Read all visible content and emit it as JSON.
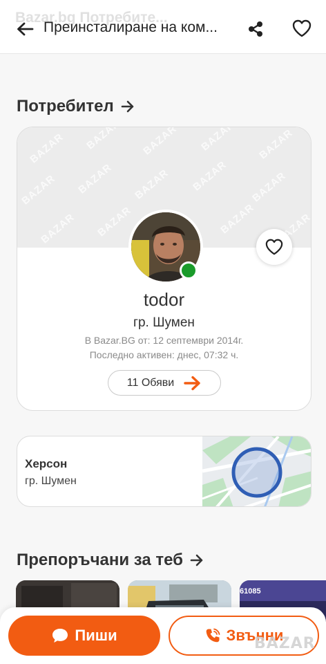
{
  "header": {
    "ghost_title": "Bazar.bg Потребите...",
    "title": "Преинсталиране на ком...",
    "icons": {
      "back": "arrow-left-icon",
      "share": "share-icon",
      "favorite": "heart-outline-icon"
    }
  },
  "user_section": {
    "heading": "Потребител",
    "name": "todor",
    "city": "гр. Шумен",
    "member_since": "В Bazar.BG от: 12 септември 2014г.",
    "last_active": "Последно активен: днес, 07:32 ч.",
    "ads_button": "11 Обяви",
    "online": true,
    "watermark_text": "BAZAR"
  },
  "location": {
    "name": "Херсон",
    "city": "гр. Шумен"
  },
  "recommended": {
    "heading": "Препоръчани за теб",
    "thumb_text": "61085"
  },
  "actions": {
    "write_label": "Пиши",
    "call_label": "Звънни"
  },
  "logo_watermark": "BAZAR",
  "colors": {
    "accent": "#f25c12",
    "online": "#1a9b2a",
    "background": "#f7f7f7"
  }
}
